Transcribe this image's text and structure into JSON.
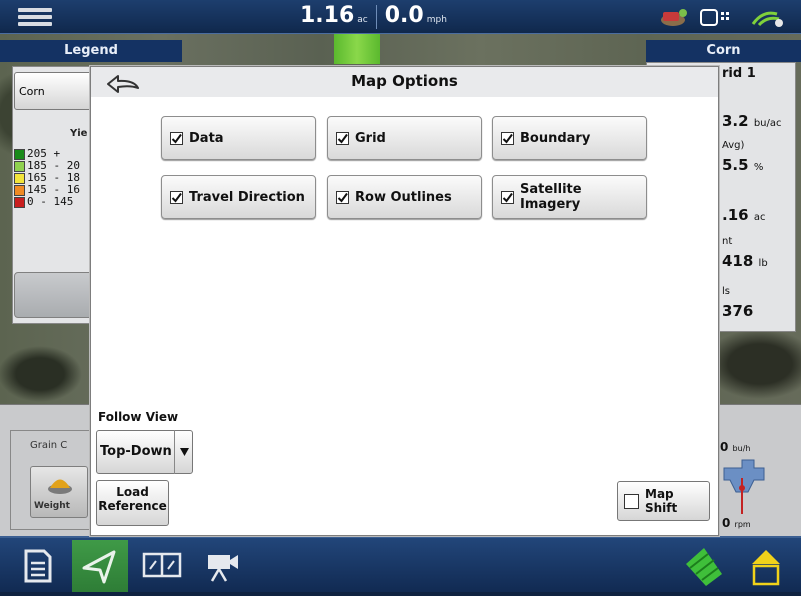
{
  "topbar": {
    "area_value": "1.16",
    "area_unit": "ac",
    "speed_value": "0.0",
    "speed_unit": "mph",
    "icons": [
      "menu-icon",
      "gps-icon",
      "display-status-icon",
      "signal-icon"
    ]
  },
  "legend": {
    "tab_label": "Legend",
    "crop": "Corn",
    "heading": "Yie",
    "rows": [
      {
        "label": "205 +",
        "color": "#1a8a1a"
      },
      {
        "label": "185 - 20",
        "color": "#8fd14f"
      },
      {
        "label": "165 - 18",
        "color": "#f2e43a"
      },
      {
        "label": "145 - 16",
        "color": "#f08a24"
      },
      {
        "label": "0 - 145",
        "color": "#c81e1e"
      }
    ]
  },
  "right_panel": {
    "tab_label": "Corn",
    "grid_label": "rid 1",
    "yield_value": "3.2",
    "yield_unit": "bu/ac",
    "moisture_label": "Avg)",
    "moisture_value": "5.5",
    "moisture_unit": "%",
    "area_value": ".16",
    "area_unit": "ac",
    "weight_label": "nt",
    "weight_value": "418",
    "weight_unit": "lb",
    "count_label": "ls",
    "count_value": "376"
  },
  "lower": {
    "grain_label": "Grain C",
    "weight_button": "Weight",
    "flow_value": "0",
    "flow_unit": "bu/h",
    "rpm_value": "0",
    "rpm_unit": "rpm"
  },
  "dialog": {
    "title": "Map Options",
    "options": [
      {
        "label": "Data",
        "checked": true
      },
      {
        "label": "Grid",
        "checked": true
      },
      {
        "label": "Boundary",
        "checked": true
      },
      {
        "label": "Travel Direction",
        "checked": true
      },
      {
        "label": "Row Outlines",
        "checked": true
      },
      {
        "label": "Satellite Imagery",
        "checked": true
      }
    ],
    "follow_view_label": "Follow View",
    "follow_view_value": "Top-Down",
    "load_reference_line1": "Load",
    "load_reference_line2": "Reference",
    "map_shift_label": "Map Shift",
    "map_shift_checked": false
  },
  "bottom_nav": [
    "document-icon",
    "guidance-icon",
    "split-view-icon",
    "camera-icon",
    "field-icon",
    "home-icon"
  ]
}
